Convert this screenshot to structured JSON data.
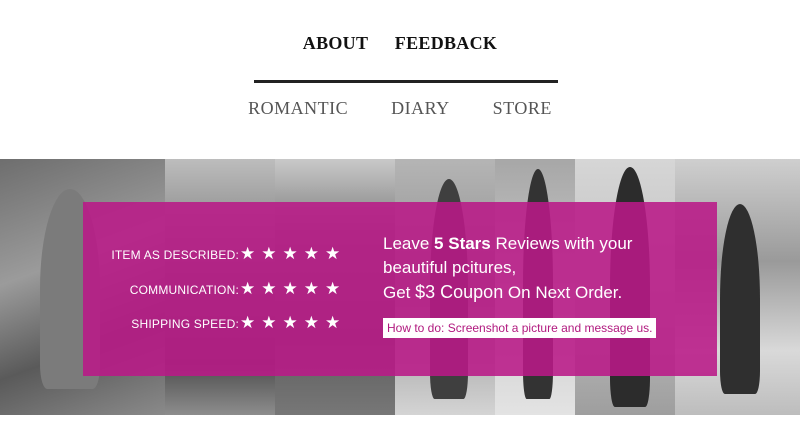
{
  "top_nav": {
    "about": "ABOUT",
    "feedback": "FEEDBACK"
  },
  "sub_nav": {
    "romantic": "ROMANTIC",
    "diary": "DIARY",
    "store": "STORE"
  },
  "promo": {
    "ratings": [
      {
        "label": "ITEM AS DESCRIBED:",
        "stars": "★★★★★",
        "score": 5
      },
      {
        "label": "COMMUNICATION:",
        "stars": "★★★★★",
        "score": 5
      },
      {
        "label": "SHIPPING SPEED:",
        "stars": "★★★★★",
        "score": 5
      }
    ],
    "line1_prefix": "Leave ",
    "line1_bold": "5 Stars",
    "line1_suffix": " Reviews with your",
    "line2": "beautiful pcitures,",
    "line3_prefix": "Get ",
    "line3_coupon": "$3 Coupon",
    "line3_suffix": "  On Next Order.",
    "howto": "How to do: Screenshot a picture and message us."
  },
  "colors": {
    "promo_bg": "#b91987",
    "text_dark": "#111111",
    "subnav_text": "#555555",
    "howto_text": "#b1197f"
  }
}
